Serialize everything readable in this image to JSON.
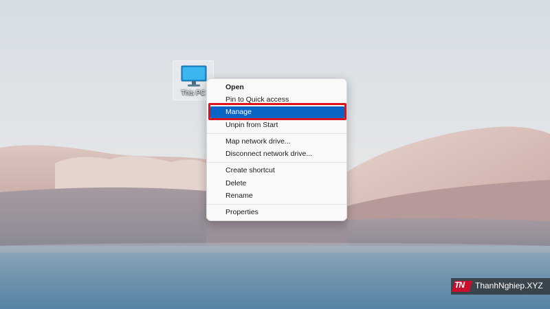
{
  "desktop": {
    "icon": {
      "label": "This PC",
      "icon_name": "monitor-icon"
    }
  },
  "context_menu": {
    "items": [
      {
        "label": "Open",
        "bold": true
      },
      {
        "label": "Pin to Quick access"
      },
      {
        "label": "Manage",
        "highlighted": true
      },
      {
        "label": "Unpin from Start"
      },
      {
        "label": "Map network drive..."
      },
      {
        "label": "Disconnect network drive..."
      },
      {
        "label": "Create shortcut"
      },
      {
        "label": "Delete"
      },
      {
        "label": "Rename"
      },
      {
        "label": "Properties"
      }
    ]
  },
  "annotation": {
    "highlight_color": "#d9141c",
    "selected_color": "#0a64c5"
  },
  "watermark": {
    "logo": "TN",
    "text": "ThanhNghiep.XYZ"
  }
}
